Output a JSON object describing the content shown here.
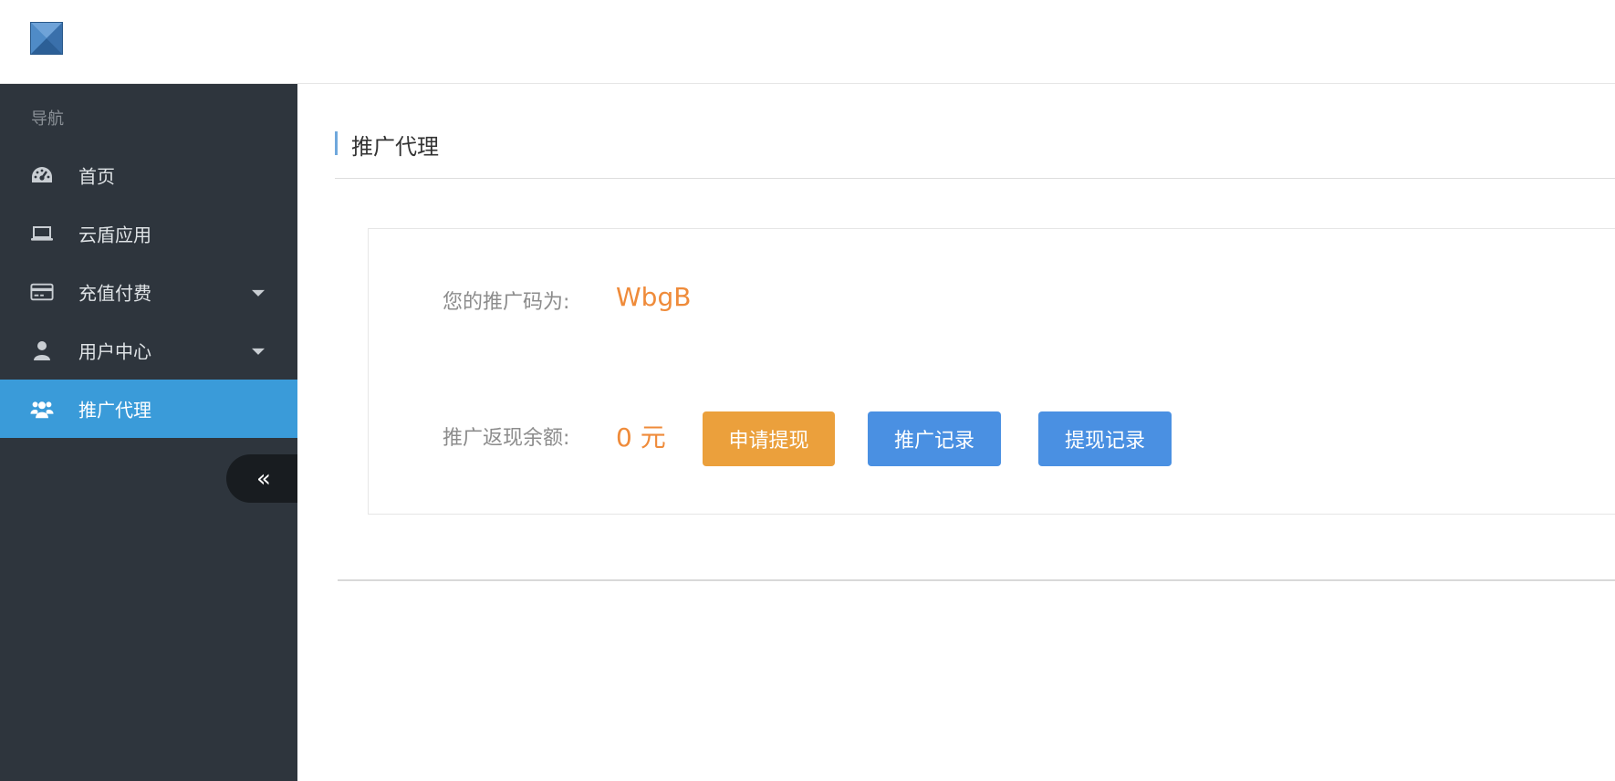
{
  "header": {
    "logo_icon": "broken-image-icon"
  },
  "sidebar": {
    "nav_title": "导航",
    "items": [
      {
        "label": "首页",
        "icon": "dashboard-icon",
        "has_caret": false,
        "active": false
      },
      {
        "label": "云盾应用",
        "icon": "laptop-icon",
        "has_caret": false,
        "active": false
      },
      {
        "label": "充值付费",
        "icon": "credit-card-icon",
        "has_caret": true,
        "active": false
      },
      {
        "label": "用户中心",
        "icon": "user-icon",
        "has_caret": true,
        "active": false
      },
      {
        "label": "推广代理",
        "icon": "users-icon",
        "has_caret": false,
        "active": true
      }
    ],
    "collapse_glyph": "«"
  },
  "main": {
    "page_title": "推广代理",
    "promo_code_label": "您的推广码为:",
    "promo_code_value": "WbgB",
    "balance_label": "推广返现余额:",
    "balance_value": "0 元",
    "buttons": {
      "withdraw": "申请提现",
      "promo_records": "推广记录",
      "withdraw_records": "提现记录"
    }
  },
  "colors": {
    "sidebar_bg": "#2e353d",
    "active_item": "#3a9bd9",
    "accent_orange": "#ef8b3a",
    "button_orange": "#eba03c",
    "button_blue": "#4a90e2"
  }
}
